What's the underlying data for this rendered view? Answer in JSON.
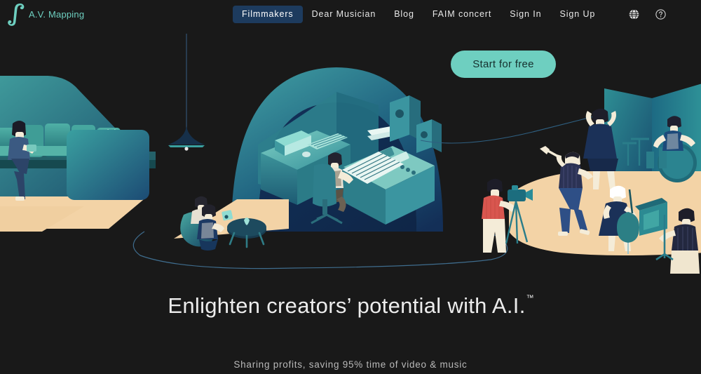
{
  "brand": {
    "name": "A.V. Mapping",
    "logo_icon": "music-note-logo-icon",
    "accent_color": "#6ecfc0"
  },
  "nav": {
    "items": [
      {
        "label": "Filmmakers",
        "active": true
      },
      {
        "label": "Dear Musician",
        "active": false
      },
      {
        "label": "Blog",
        "active": false
      },
      {
        "label": "FAIM concert",
        "active": false
      },
      {
        "label": "Sign In",
        "active": false
      },
      {
        "label": "Sign Up",
        "active": false
      }
    ],
    "icons": [
      {
        "name": "globe-icon"
      },
      {
        "name": "help-circle-icon"
      }
    ],
    "active_pill_color": "#1d3b5e"
  },
  "cta": {
    "label": "Start for free",
    "background_color": "#6ecfc0",
    "text_color": "#16302e"
  },
  "hero": {
    "headline": "Enlighten creators’ potential with A.I.",
    "trademark": "™",
    "subline": "Sharing profits, saving 95% time of video & music",
    "illustration_name": "creators-studio-stage-illustration",
    "scenes": [
      "living-room-viewers-with-cat",
      "lounge-with-tablet-readers",
      "music-studio-under-arch",
      "stage-with-musicians-and-camera-crew"
    ],
    "palette": {
      "background": "#191919",
      "teal_light": "#7fd4c8",
      "teal_mid": "#2f8f92",
      "teal_deep": "#1b5f74",
      "navy": "#16355c",
      "navy_deep": "#122a4a",
      "sand": "#f3d3a6",
      "cream": "#f4ecd8",
      "red": "#d9564f",
      "line": "#3f6d8e"
    }
  }
}
